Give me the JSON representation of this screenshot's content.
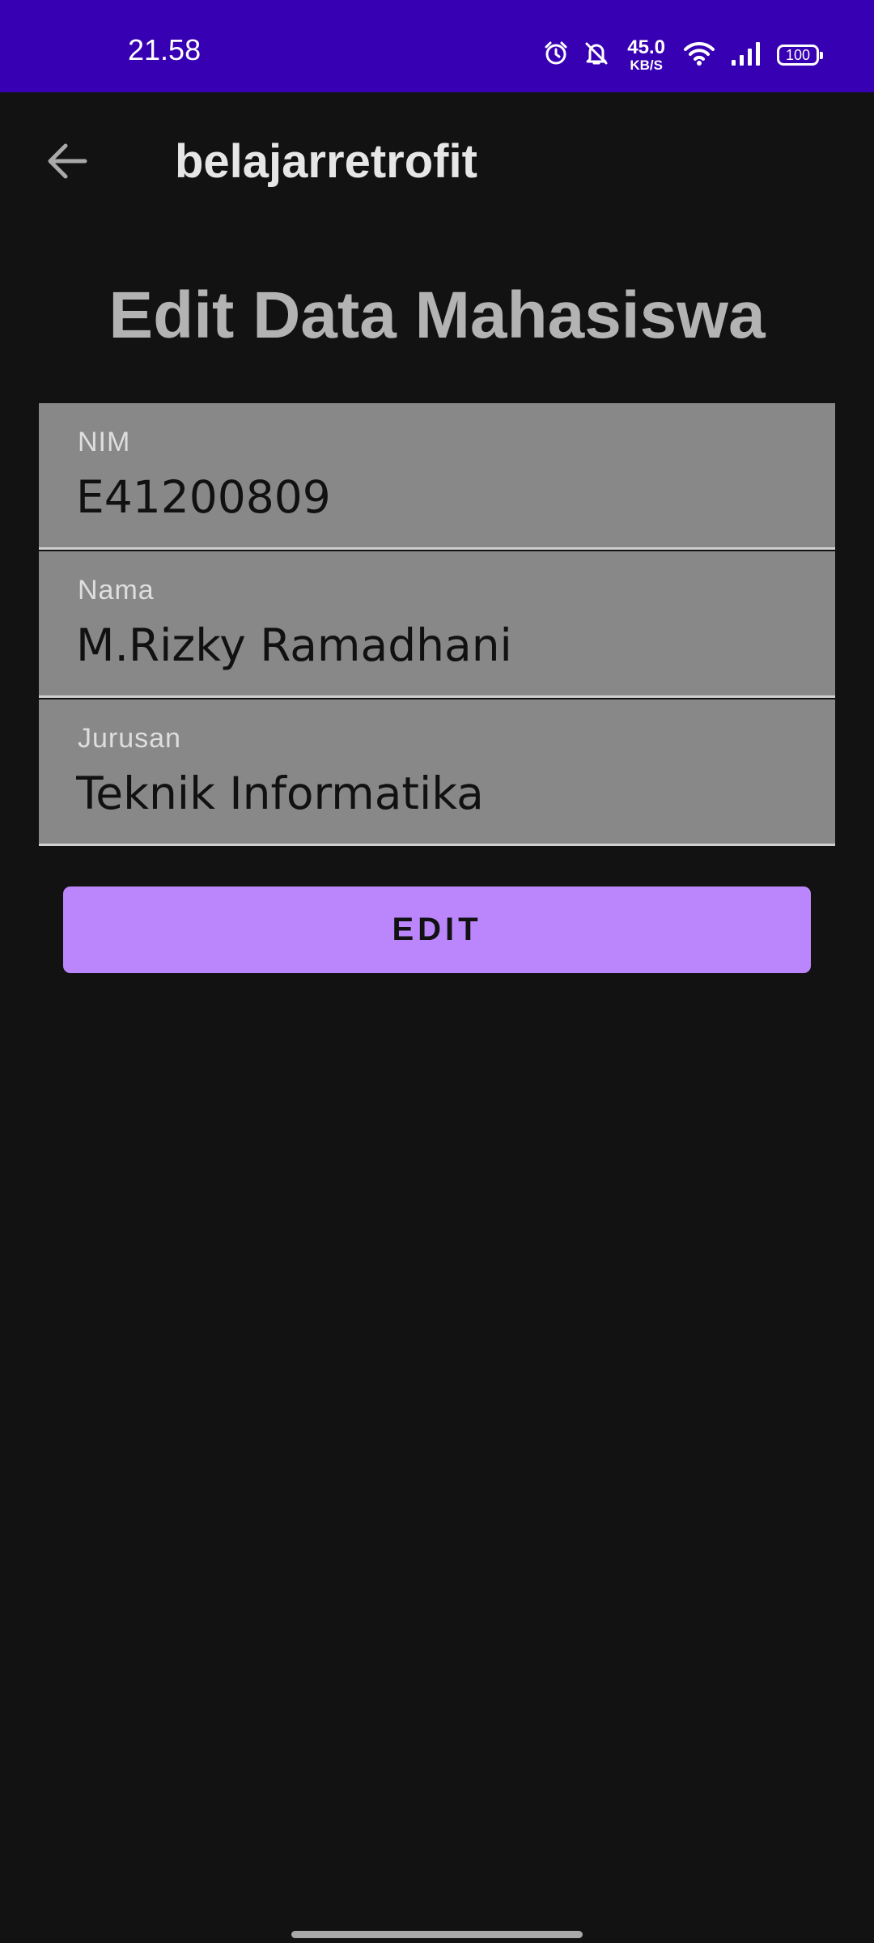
{
  "status_bar": {
    "time": "21.58",
    "net_speed_value": "45.0",
    "net_speed_unit": "KB/S",
    "battery_level": "100",
    "icons": [
      "alarm-icon",
      "bell-muted-icon",
      "wifi-icon",
      "signal-icon",
      "battery-icon"
    ],
    "background_color": "#3700b3"
  },
  "app_bar": {
    "title": "belajarretrofit",
    "back_icon": "arrow-back-icon"
  },
  "page": {
    "title": "Edit Data Mahasiswa"
  },
  "form": {
    "fields": [
      {
        "label": "NIM",
        "value": "E41200809"
      },
      {
        "label": "Nama",
        "value": "M.Rizky Ramadhani"
      },
      {
        "label": "Jurusan",
        "value": "Teknik Informatika"
      }
    ],
    "submit_label": "EDIT"
  },
  "colors": {
    "background": "#121212",
    "field_background": "#888888",
    "accent": "#bb86fc"
  }
}
